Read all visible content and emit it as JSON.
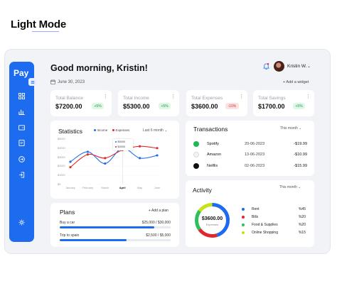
{
  "page": {
    "heading": "Light Mode"
  },
  "app": {
    "brand": "Pay"
  },
  "header": {
    "greeting": "Good morning, Kristin!",
    "date": "June 30, 2023",
    "add_widget": "+ Add a widget",
    "user_name": "Kristin W.",
    "user_chevron": "⌄"
  },
  "sidebar": {
    "icons": [
      "grid-icon",
      "bar-chart-icon",
      "wallet-icon",
      "document-icon",
      "arrow-circle-icon",
      "logout-icon",
      "settings-icon"
    ]
  },
  "stats": [
    {
      "title": "Total Balance",
      "value": "$7200.00",
      "change": "+5%",
      "trend": "up"
    },
    {
      "title": "Total Income",
      "value": "$5300.00",
      "change": "+5%",
      "trend": "up"
    },
    {
      "title": "Total Expenses",
      "value": "$3600.00",
      "change": "-10%",
      "trend": "down"
    },
    {
      "title": "Total Savings",
      "value": "$1700.00",
      "change": "+5%",
      "trend": "up"
    }
  ],
  "statistics": {
    "title": "Statistics",
    "period": "Last 6 month",
    "legend": [
      {
        "name": "Income",
        "color": "#1d6cf0"
      },
      {
        "name": "Expenses",
        "color": "#e0282c"
      }
    ],
    "tooltip": {
      "income": "$5000",
      "expenses": "$4000"
    }
  },
  "chart_data": {
    "type": "line",
    "categories": [
      "January",
      "February",
      "March",
      "April",
      "May",
      "June"
    ],
    "y_ticks": [
      "$5000",
      "$4000",
      "$3000",
      "$2000",
      "$1000",
      "$0"
    ],
    "ylim": [
      0,
      5000
    ],
    "highlight_category": "April",
    "series": [
      {
        "name": "Income",
        "color": "#1d6cf0",
        "values": [
          2500,
          3600,
          2300,
          4000,
          2900,
          3200
        ]
      },
      {
        "name": "Expenses",
        "color": "#e0282c",
        "values": [
          1900,
          3300,
          2900,
          3800,
          4200,
          4000
        ]
      }
    ]
  },
  "transactions": {
    "title": "Transactions",
    "period": "This month",
    "items": [
      {
        "name": "Spotify",
        "date": "20-06-2023",
        "amount": "-$19.99",
        "color": "#1db954"
      },
      {
        "name": "Amazon",
        "date": "13-06-2023",
        "amount": "-$10.99",
        "color": "#333333"
      },
      {
        "name": "Netflix",
        "date": "02-06-2023",
        "amount": "-$15.99",
        "color": "#111111"
      }
    ]
  },
  "plans": {
    "title": "Plans",
    "add_plan": "+ Add a plan",
    "items": [
      {
        "name": "Buy a car",
        "progress": 0.85,
        "amount": "$25,000 / $30,000"
      },
      {
        "name": "Trip to spain",
        "progress": 0.6,
        "amount": "$2,500 / $5,000"
      }
    ]
  },
  "activity": {
    "title": "Activity",
    "period": "This month",
    "total": "$3600.00",
    "total_label": "Expenses",
    "items": [
      {
        "label": "Rent",
        "pct": "%45",
        "value": 45,
        "color": "#1d6cf0"
      },
      {
        "label": "Bills",
        "pct": "%20",
        "value": 20,
        "color": "#e0282c"
      },
      {
        "label": "Food & Supplies",
        "pct": "%20",
        "value": 20,
        "color": "#2fbf5b"
      },
      {
        "label": "Online Shopping",
        "pct": "%15",
        "value": 15,
        "color": "#c6e21b"
      }
    ]
  }
}
